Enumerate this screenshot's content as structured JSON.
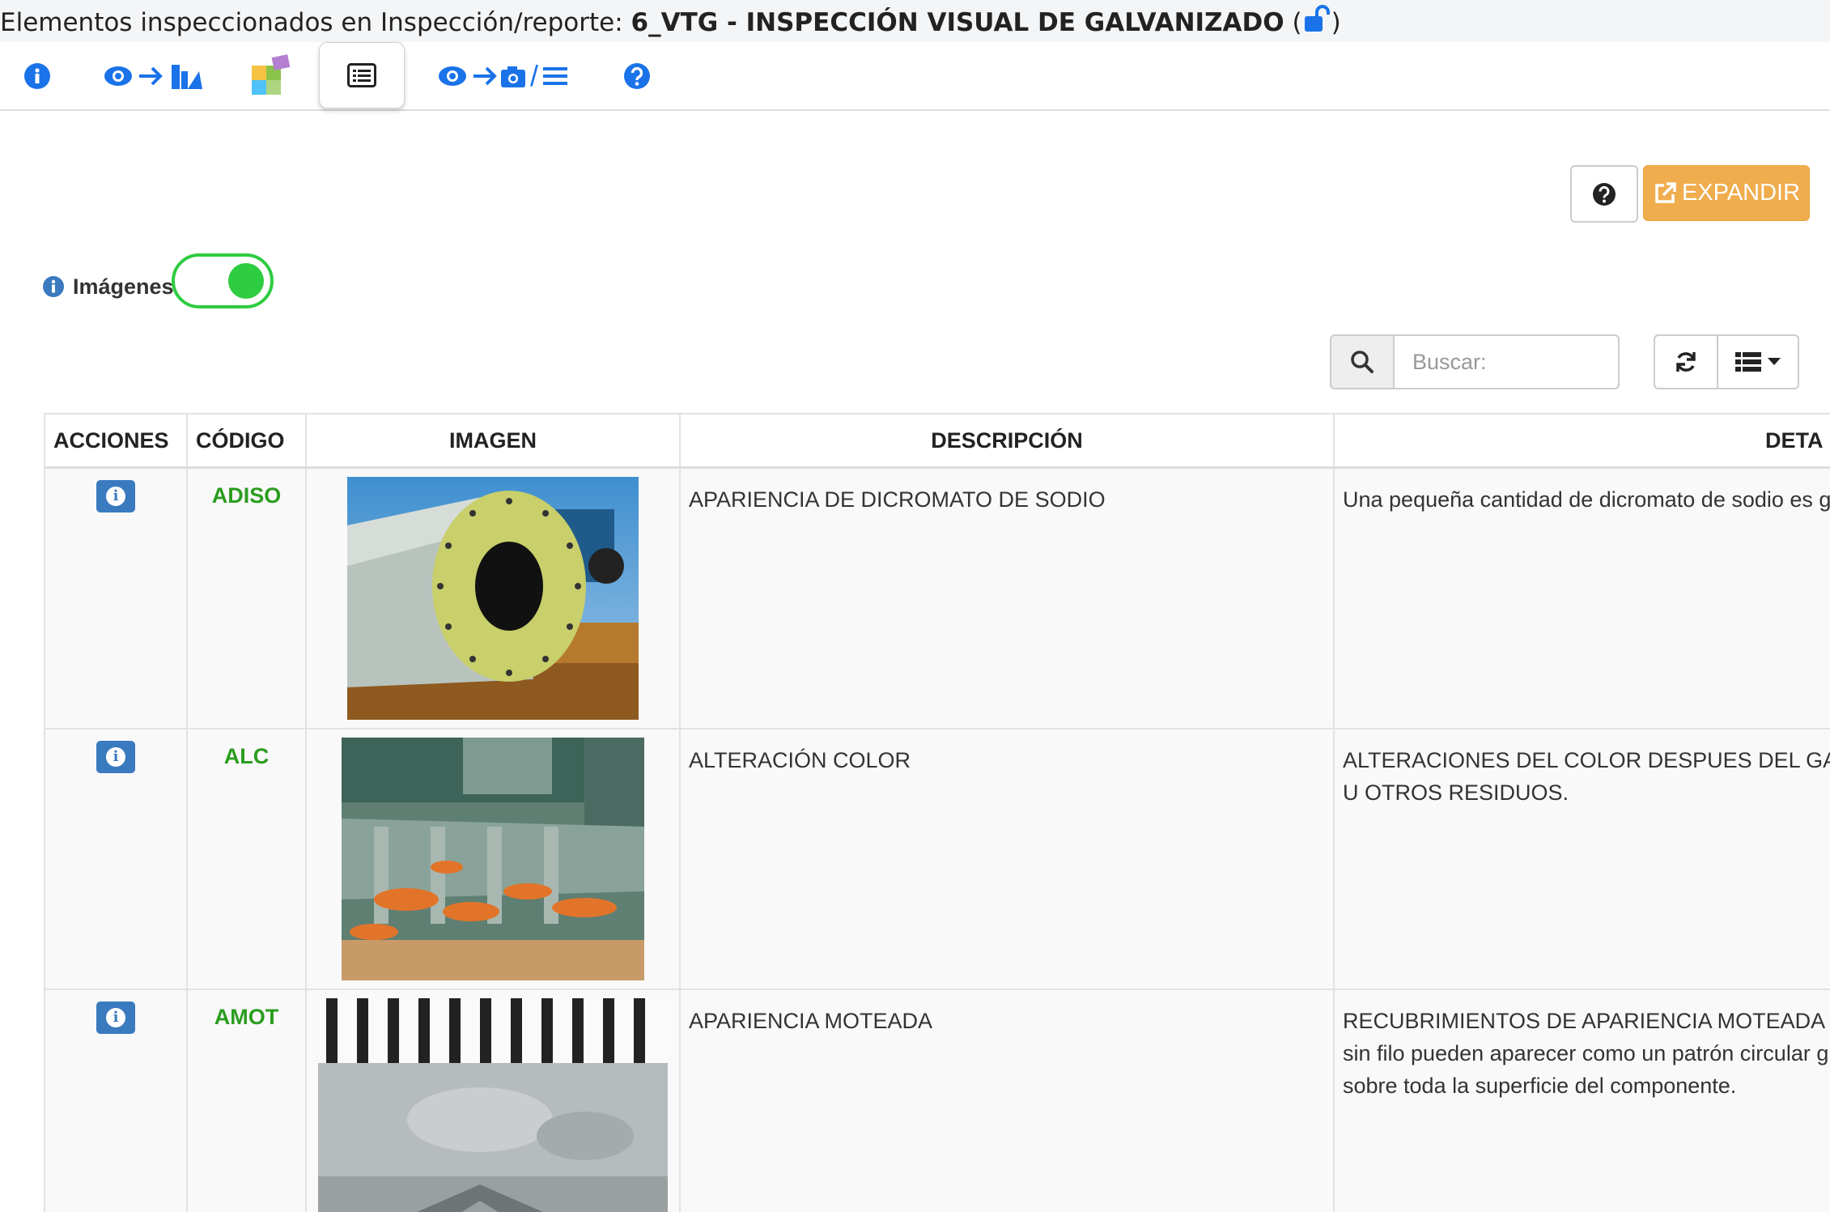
{
  "title": {
    "prefix": "Elementos inspeccionados en Inspección/reporte: ",
    "code": "6_VTG",
    "separator": " - ",
    "name": "INSPECCIÓN VISUAL DE GALVANIZADO",
    "open_paren": "(",
    "close_paren": ")"
  },
  "nav": {
    "slash": "/"
  },
  "toolbar": {
    "expand_label": "EXPANDIR",
    "images_label": "Imágenes",
    "images_enabled": true
  },
  "search": {
    "placeholder": "Buscar:"
  },
  "table": {
    "headers": [
      "ACCIONES",
      "CÓDIGO",
      "IMAGEN",
      "DESCRIPCIÓN",
      "DETA"
    ],
    "rows": [
      {
        "code": "ADISO",
        "description": "APARIENCIA DE DICROMATO DE SODIO",
        "detail_lines": [
          "Una pequeña cantidad de dicromato de sodio es generalme"
        ]
      },
      {
        "code": "ALC",
        "description": "ALTERACIÓN COLOR",
        "detail_lines": [
          "ALTERACIONES DEL COLOR DESPUES DEL GALVANIZ",
          "U OTROS RESIDUOS."
        ]
      },
      {
        "code": "AMOT",
        "description": "APARIENCIA MOTEADA",
        "detail_lines": [
          "RECUBRIMIENTOS DE APARIENCIA MOTEADA O GRISE",
          "sin filo pueden aparecer como un patrón circular gris oscuro",
          "sobre toda la superficie del componente."
        ]
      }
    ]
  },
  "colors": {
    "accent_blue": "#1a73e8",
    "code_green": "#2a9d1e",
    "toggle_green": "#2ecc40",
    "expand_orange": "#f0ad4e",
    "action_blue": "#3a7abf"
  }
}
